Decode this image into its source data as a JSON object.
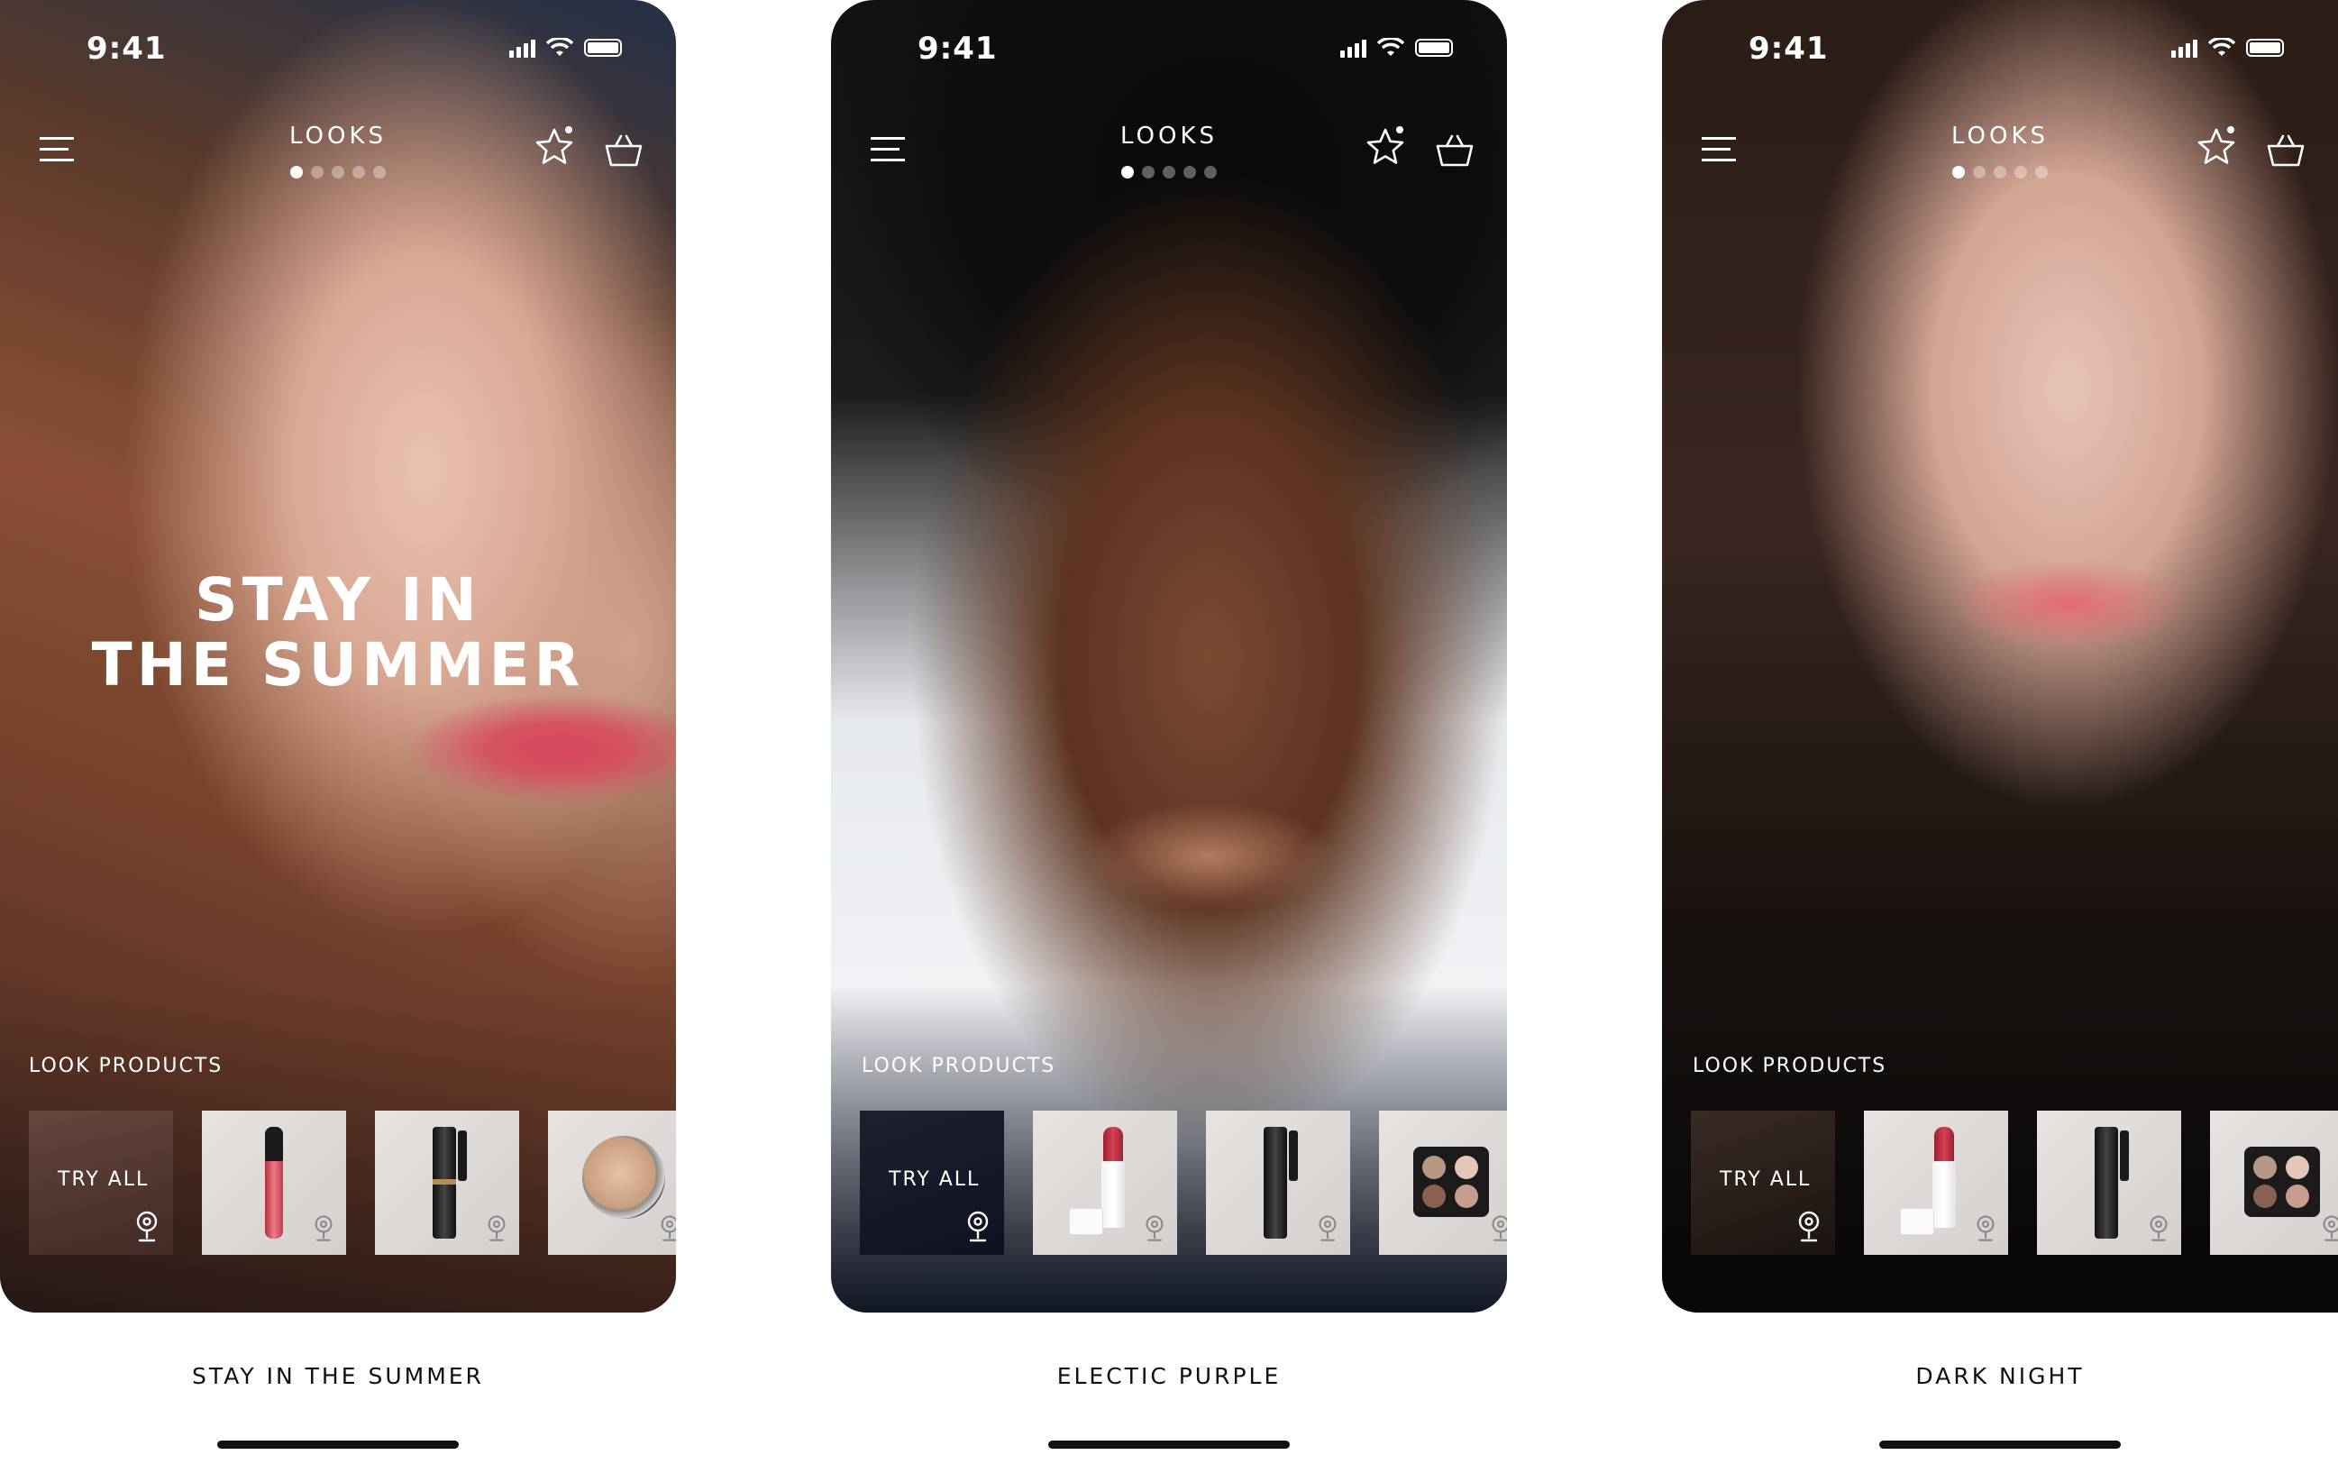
{
  "screens": [
    {
      "status": {
        "time": "9:41"
      },
      "header": {
        "title": "LOOKS"
      },
      "headline": {
        "line1": "STAY IN",
        "line2": "THE SUMMER"
      },
      "products_label": "LOOK PRODUCTS",
      "try_all_label": "TRY ALL",
      "caption": "STAY IN THE SUMMER"
    },
    {
      "status": {
        "time": "9:41"
      },
      "header": {
        "title": "LOOKS"
      },
      "products_label": "LOOK PRODUCTS",
      "try_all_label": "TRY ALL",
      "caption": "ELECTIC PURPLE"
    },
    {
      "status": {
        "time": "9:41"
      },
      "header": {
        "title": "LOOKS"
      },
      "products_label": "LOOK PRODUCTS",
      "try_all_label": "TRY ALL",
      "caption": "DARK NIGHT"
    }
  ],
  "icons": {
    "menu": "hamburger-menu-icon",
    "favorite": "star-icon",
    "cart": "shopping-basket-icon",
    "try_on": "location-pin-icon"
  },
  "pager": {
    "pages": 5,
    "active": 1
  }
}
